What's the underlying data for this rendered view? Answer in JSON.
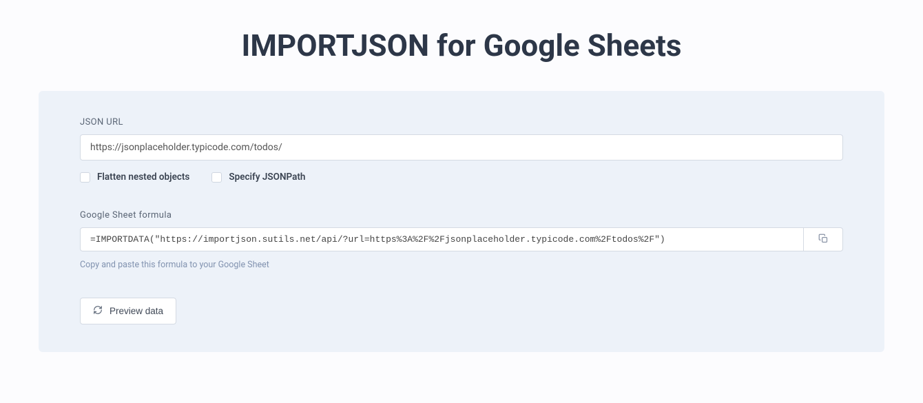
{
  "page": {
    "title": "IMPORTJSON for Google Sheets"
  },
  "form": {
    "url_label": "JSON URL",
    "url_value": "https://jsonplaceholder.typicode.com/todos/",
    "flatten_label": "Flatten nested objects",
    "jsonpath_label": "Specify JSONPath",
    "formula_label": "Google Sheet formula",
    "formula_value": "=IMPORTDATA(\"https://importjson.sutils.net/api/?url=https%3A%2F%2Fjsonplaceholder.typicode.com%2Ftodos%2F\")",
    "helper_text": "Copy and paste this formula to your Google Sheet",
    "preview_label": "Preview data"
  }
}
